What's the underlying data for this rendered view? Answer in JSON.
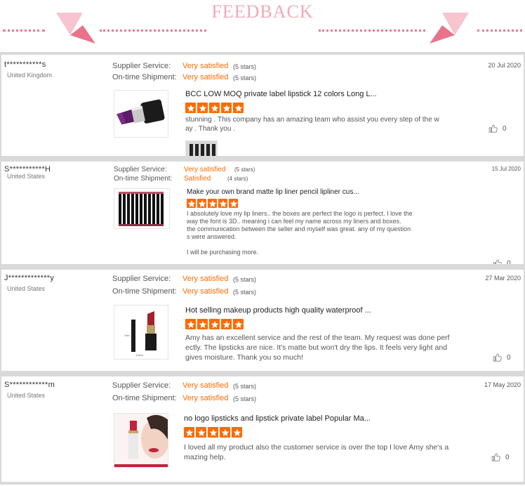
{
  "header": {
    "title": "FEEDBACK"
  },
  "labels": {
    "supplier_service": "Supplier Service:",
    "ontime_shipment": "On-time Shipment:"
  },
  "colors": {
    "accent": "#ff6a00",
    "header_pink": "#f2a9b6",
    "divider": "#d9d9d9"
  },
  "reviews": [
    {
      "buyer": "t***********s",
      "country": "United Kingdom",
      "supplier_value": "Very satisfied",
      "supplier_stars": "(5 stars)",
      "shipment_value": "Very satisfied",
      "shipment_stars": "(5 stars)",
      "date": "20 Jul 2020",
      "product_title": "BCC LOW MOQ private label lipstick 12 colors Long L...",
      "rating": 5,
      "text": "stunning . This company has an amazing team who assist you every step of the w\nay . Thank you .",
      "likes": "0",
      "product_icon": "purple-lipstick-icon"
    },
    {
      "buyer": "S***********H",
      "country": "United States",
      "supplier_value": "Very satisfied",
      "supplier_stars": "(5 stars)",
      "shipment_value": "Satisfied",
      "shipment_stars": "(4 stars)",
      "date": "15 Jul 2020",
      "product_title": "Make your own brand matte lip liner pencil lipliner cus...",
      "rating": 5,
      "text": "I absolutely love my lip liners.. the boxes are perfect the logo is perfect. I  love the\nway the font is 3D.. meaning i can feel my name across my liners and boxes.\nthe communication between the seller and myself was great. any of my question\ns were answered.\n\nI will be purchasing more.\n\nthank you",
      "likes": "0",
      "product_icon": "lip-liner-pencils-icon"
    },
    {
      "buyer": "J*************y",
      "country": "United States",
      "supplier_value": "Very satisfied",
      "supplier_stars": "(5 stars)",
      "shipment_value": "Very satisfied",
      "shipment_stars": "(5 stars)",
      "date": "27 Mar 2020",
      "product_title": "Hot selling makeup products high quality waterproof ...",
      "rating": 5,
      "text": "Amy has an excellent service and the rest of the team. My request was done perf\nectly. The lipsticks are nice. It's matte but won't dry the lips. It feels very light and\ngives moisture. Thank you so much!",
      "likes": "0",
      "product_icon": "red-lipstick-icon"
    },
    {
      "buyer": "S************m",
      "country": "United States",
      "supplier_value": "Very satisfied",
      "supplier_stars": "(5 stars)",
      "shipment_value": "Very satisfied",
      "shipment_stars": "(5 stars)",
      "date": "17 May 2020",
      "product_title": "no logo lipsticks and lipstick private label Popular Ma...",
      "rating": 5,
      "text": "I loved all my product also the customer service is over the top I love Amy she's a\nmazing help.",
      "likes": "0",
      "product_icon": "lipstick-model-icon"
    }
  ]
}
